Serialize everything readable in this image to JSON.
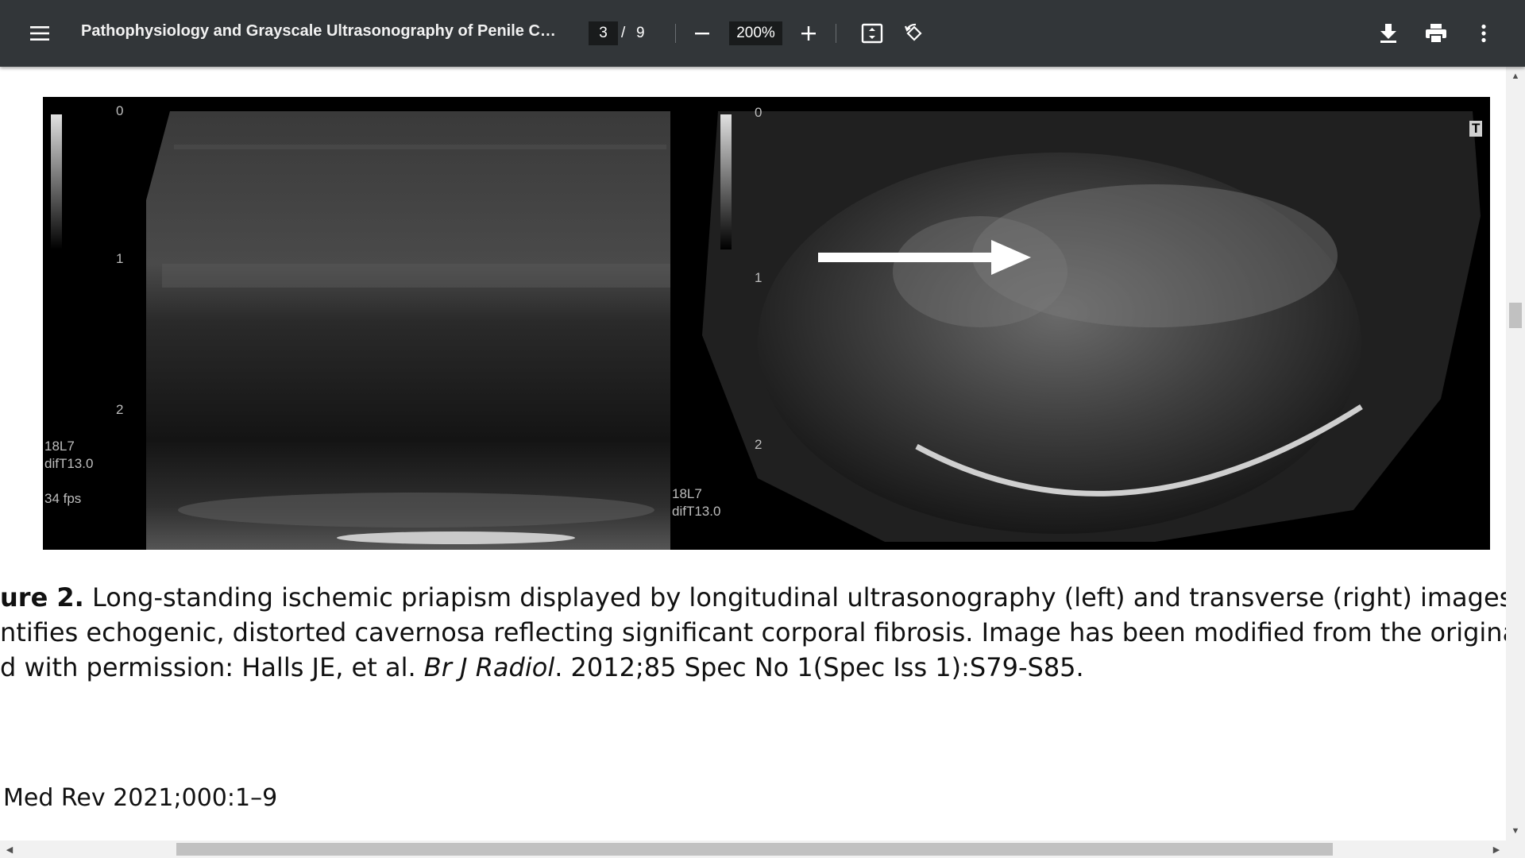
{
  "toolbar": {
    "menu_icon": "hamburger-menu-icon",
    "title": "Pathophysiology and Grayscale Ultrasonography of Penile Corp...",
    "page_current": "3",
    "page_separator": "/",
    "page_total": "9",
    "zoom_out_icon": "minus-icon",
    "zoom_value": "200%",
    "zoom_in_icon": "plus-icon",
    "fit_icon": "fit-to-page-icon",
    "rotate_icon": "rotate-icon",
    "download_icon": "download-icon",
    "print_icon": "print-icon",
    "more_icon": "more-vert-icon",
    "background": "#323639"
  },
  "figure": {
    "left_scan": {
      "depth_0": "0",
      "depth_1": "1",
      "depth_2": "2",
      "probe": "18L7",
      "setting": "difT13.0",
      "fps": "34 fps"
    },
    "right_scan": {
      "depth_0": "0",
      "depth_1": "1",
      "depth_2": "2",
      "probe": "18L7",
      "setting": "difT13.0",
      "marker": "T"
    }
  },
  "caption": {
    "label": "ure 2.",
    "line1": " Long-standing ischemic priapism displayed by longitudinal ultrasonography (left) and transverse (right) images. The",
    "line2": "ntifies echogenic, distorted cavernosa reflecting significant corporal fibrosis. Image has been modified from the original sourc",
    "line3_pre": "d with permission: Halls JE, et al. ",
    "line3_journal": "Br J Radiol",
    "line3_post": ". 2012;85 Spec No 1(Spec Iss 1):S79-S85."
  },
  "footer": {
    "citation": "Med Rev 2021;000:1–9"
  }
}
